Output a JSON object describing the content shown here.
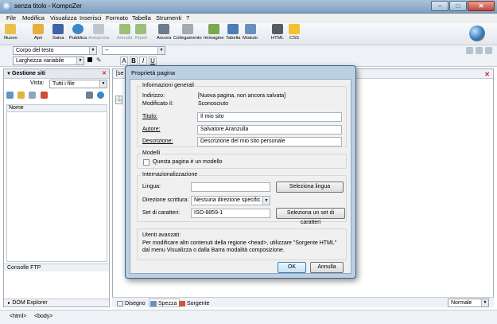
{
  "window": {
    "title": "senza titolo - KompoZer"
  },
  "menu": [
    "File",
    "Modifica",
    "Visualizza",
    "Inserisci",
    "Formato",
    "Tabella",
    "Strumenti",
    "?"
  ],
  "toolbar": [
    {
      "label": "Nuovo",
      "icon": "new-icon",
      "color": "#e9c04b",
      "enabled": true
    },
    {
      "label": "Apri",
      "icon": "open-folder-icon",
      "color": "#e2b23b",
      "enabled": true
    },
    {
      "label": "Salva",
      "icon": "save-icon",
      "color": "#3e63a8",
      "enabled": true
    },
    {
      "label": "Pubblica",
      "icon": "globe-icon",
      "color": "#3a86c8",
      "enabled": true
    },
    {
      "label": "Anteprima",
      "icon": "preview-icon",
      "color": "#bfc6ce",
      "enabled": false
    },
    {
      "label": "Annulla",
      "icon": "undo-icon",
      "color": "#9bbf7a",
      "enabled": false
    },
    {
      "label": "Ripeti",
      "icon": "redo-icon",
      "color": "#9bbf7a",
      "enabled": false
    },
    {
      "label": "Ancora",
      "icon": "anchor-icon",
      "color": "#6d7c8b",
      "enabled": true
    },
    {
      "label": "Collegamento",
      "icon": "link-icon",
      "color": "#a4aab1",
      "enabled": true
    },
    {
      "label": "Immagine",
      "icon": "image-icon",
      "color": "#7aa84f",
      "enabled": true
    },
    {
      "label": "Tabella",
      "icon": "table-icon",
      "color": "#4f7cb6",
      "enabled": true
    },
    {
      "label": "Modulo",
      "icon": "form-icon",
      "color": "#6a8fbf",
      "enabled": true
    },
    {
      "label": "HTML",
      "icon": "html-icon",
      "color": "#555b62",
      "enabled": true
    },
    {
      "label": "CSS",
      "icon": "css-icon",
      "color": "#f2c232",
      "enabled": true
    }
  ],
  "format": {
    "paragraph_style": "Corpo del testo",
    "font": "--",
    "width_style": "Larghezza variabile",
    "bold": "B",
    "italic": "I",
    "underline": "U"
  },
  "sidebar": {
    "title": "Gestione siti",
    "view_label": "Vista:",
    "view_value": "Tutti i file",
    "list_header": "Nome",
    "ftp_console": "Consolle FTP",
    "dom_explorer": "DOM Explorer"
  },
  "editor": {
    "tab_fragment": "[se",
    "modes": [
      "Disegno",
      "Spezza",
      "Sorgente"
    ],
    "view_mode": "Normale"
  },
  "statusbar": {
    "items": [
      "<html>",
      "<body>"
    ]
  },
  "dialog": {
    "title": "Proprietà pagina",
    "general": {
      "legend": "Informazioni generali",
      "address_label": "Indirizzo:",
      "address_value": "[Nuova pagina, non ancora salvata]",
      "modified_label": "Modificato il:",
      "modified_value": "Sconosciuto",
      "title_label": "Titolo:",
      "title_value": "Il mio sito",
      "author_label": "Autore:",
      "author_value": "Salvatore Aranzulla",
      "description_label": "Descrizione:",
      "description_value": "Descrizione del mio sito personale"
    },
    "templates": {
      "legend": "Modelli",
      "checkbox_label": "Questa pagina è un modello",
      "checked": false
    },
    "i18n": {
      "legend": "Internazionalizzazione",
      "language_label": "Lingua:",
      "language_value": "",
      "select_language": "Seleziona lingua",
      "direction_label": "Direzione scrittura:",
      "direction_value": "Nessuna direzione specific...",
      "charset_label": "Set di caratteri:",
      "charset_value": "ISO-8859-1",
      "select_charset": "Seleziona un set di caratteri"
    },
    "advanced": {
      "legend": "Utenti avanzati:",
      "text": "Per modificare altri contenuti della regione <head>, utilizzare \"Sorgente HTML\" dal menu Visualizza o dalla Barra modalità composizione."
    },
    "ok": "OK",
    "cancel": "Annulla"
  }
}
